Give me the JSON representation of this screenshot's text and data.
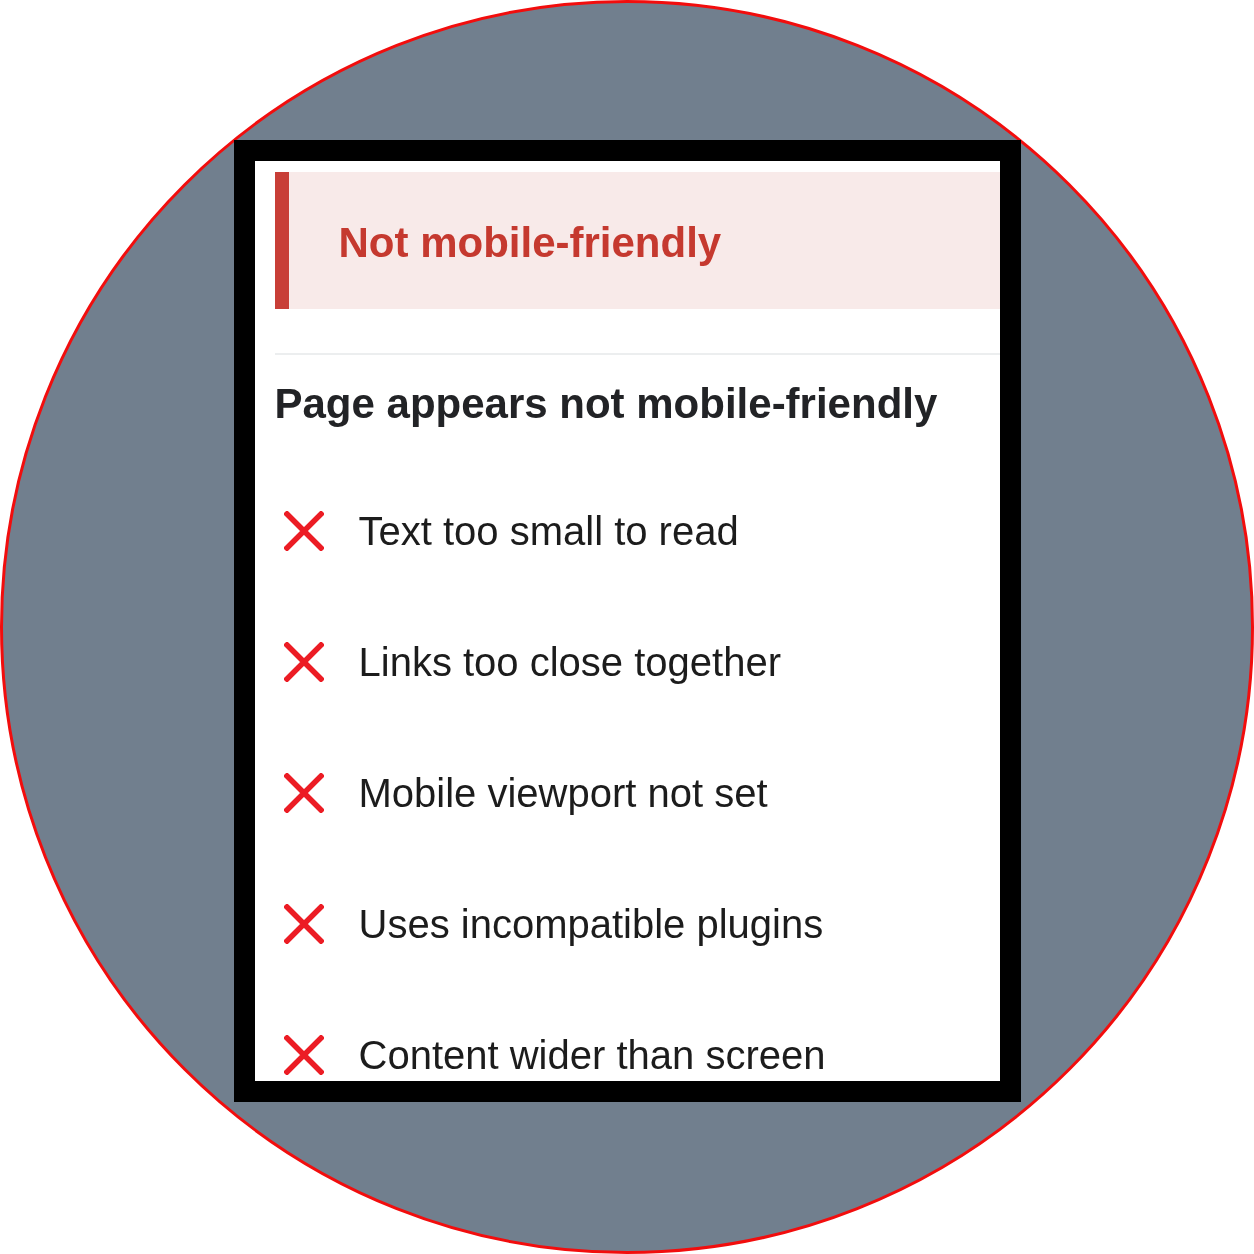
{
  "banner": {
    "title": "Not mobile-friendly"
  },
  "heading": "Page appears not mobile-friendly",
  "issues": [
    {
      "label": "Text too small to read"
    },
    {
      "label": "Links too close together"
    },
    {
      "label": "Mobile viewport not set"
    },
    {
      "label": "Uses incompatible plugins"
    },
    {
      "label": "Content wider than screen"
    }
  ]
}
